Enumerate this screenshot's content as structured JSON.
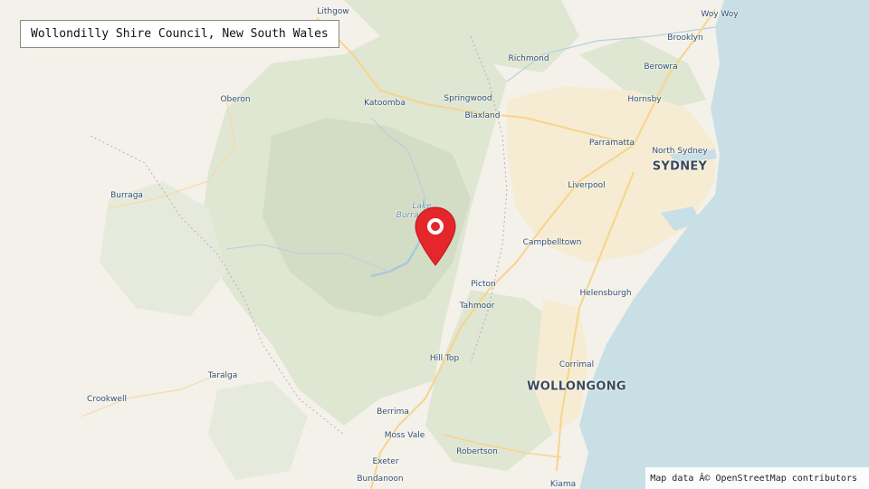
{
  "map_title": "Wollondilly Shire Council, New South Wales",
  "attribution": "Map data Â© OpenStreetMap contributors",
  "marker_icon": "location-pin-icon",
  "colors": {
    "land": "#f4f1ea",
    "forest": "#dfe6d2",
    "forest_dark": "#cfdcc0",
    "ocean": "#c9dfe6",
    "urban": "#f6ecd3",
    "road_major": "#f7d48b",
    "marker": "#e5262b"
  },
  "places": {
    "lithgow": "Lithgow",
    "richmond": "Richmond",
    "woywoy": "Woy Woy",
    "brooklyn": "Brooklyn",
    "berowra": "Berowra",
    "oberon": "Oberon",
    "katoomba": "Katoomba",
    "springwood": "Springwood",
    "hornsby": "Hornsby",
    "blaxland": "Blaxland",
    "parramatta": "Parramatta",
    "north_sydney": "North Sydney",
    "sydney": "SYDNEY",
    "burraga": "Burraga",
    "liverpool": "Liverpool",
    "lake_burragorang_1": "Lake",
    "lake_burragorang_2": "Burragorang",
    "campbelltown": "Campbelltown",
    "picton": "Picton",
    "helensburgh": "Helensburgh",
    "tahmoor": "Tahmoor",
    "hill_top": "Hill Top",
    "corrimal": "Corrimal",
    "taralga": "Taralga",
    "wollongong": "WOLLONGONG",
    "crookwell": "Crookwell",
    "berrima": "Berrima",
    "moss_vale": "Moss Vale",
    "robertson": "Robertson",
    "bundanoon": "Bundanoon",
    "exeter": "Exeter",
    "kiama": "Kiama"
  }
}
